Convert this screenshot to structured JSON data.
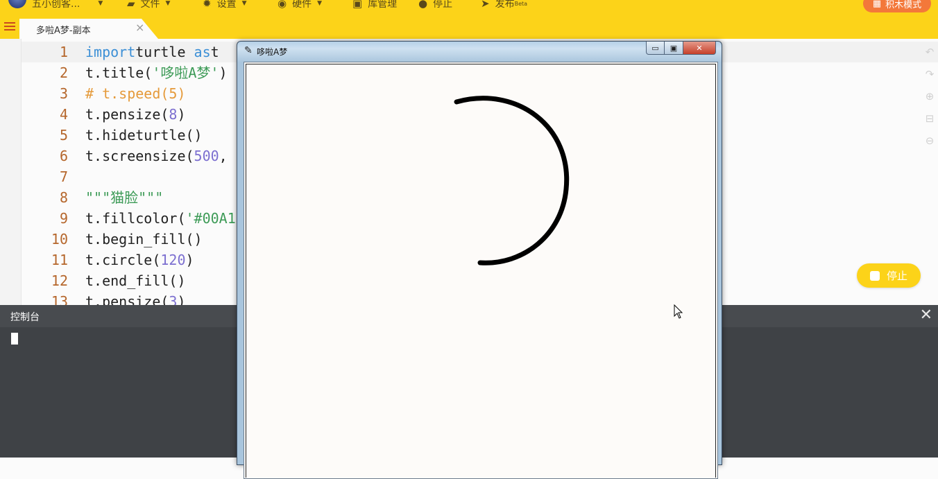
{
  "menu": {
    "account_label": "五小创客...",
    "file_label": "文件",
    "settings_label": "设置",
    "hardware_label": "硬件",
    "library_label": "库管理",
    "stop_label": "停止",
    "publish_label": "发布",
    "publish_badge": "Beta",
    "block_mode_label": "积木模式"
  },
  "tab": {
    "label": "多啦A梦-副本",
    "close": "×"
  },
  "code_lines": [
    {
      "n": "1",
      "parts": [
        [
          "kw",
          "import"
        ],
        [
          "",
          "turtle "
        ],
        [
          "kw",
          "as"
        ],
        [
          "",
          "t"
        ]
      ]
    },
    {
      "n": "2",
      "parts": [
        [
          "",
          "t.title("
        ],
        [
          "str",
          "'哆啦A梦'"
        ],
        [
          "",
          ")"
        ]
      ]
    },
    {
      "n": "3",
      "parts": [
        [
          "cmt",
          "# t.speed(5)"
        ]
      ]
    },
    {
      "n": "4",
      "parts": [
        [
          "",
          "t.pensize("
        ],
        [
          "num",
          "8"
        ],
        [
          "",
          ")"
        ]
      ]
    },
    {
      "n": "5",
      "parts": [
        [
          "",
          "t.hideturtle()"
        ]
      ]
    },
    {
      "n": "6",
      "parts": [
        [
          "",
          "t.screensize("
        ],
        [
          "num",
          "500"
        ],
        [
          "",
          ","
        ]
      ]
    },
    {
      "n": "7",
      "parts": []
    },
    {
      "n": "8",
      "parts": [
        [
          "str",
          "\"\"\"猫脸\"\"\""
        ]
      ]
    },
    {
      "n": "9",
      "parts": [
        [
          "",
          "t.fillcolor("
        ],
        [
          "str",
          "'#00A1"
        ]
      ]
    },
    {
      "n": "10",
      "parts": [
        [
          "",
          "t.begin_fill()"
        ]
      ]
    },
    {
      "n": "11",
      "parts": [
        [
          "",
          "t.circle("
        ],
        [
          "num",
          "120"
        ],
        [
          "",
          ")"
        ]
      ]
    },
    {
      "n": "12",
      "parts": [
        [
          "",
          "t.end_fill()"
        ]
      ]
    },
    {
      "n": "13",
      "parts": [
        [
          "",
          "t.pensize("
        ],
        [
          "num",
          "3"
        ],
        [
          "",
          ")"
        ]
      ]
    }
  ],
  "stop_button_label": "停止",
  "console": {
    "title": "控制台",
    "close": "✕"
  },
  "turtle_window": {
    "title": "哆啦A梦",
    "min": "▭",
    "max": "▣",
    "close": "✕"
  },
  "colors": {
    "accent": "#fcd319",
    "block_mode": "#f3783a",
    "console_bg": "#3f4246"
  }
}
